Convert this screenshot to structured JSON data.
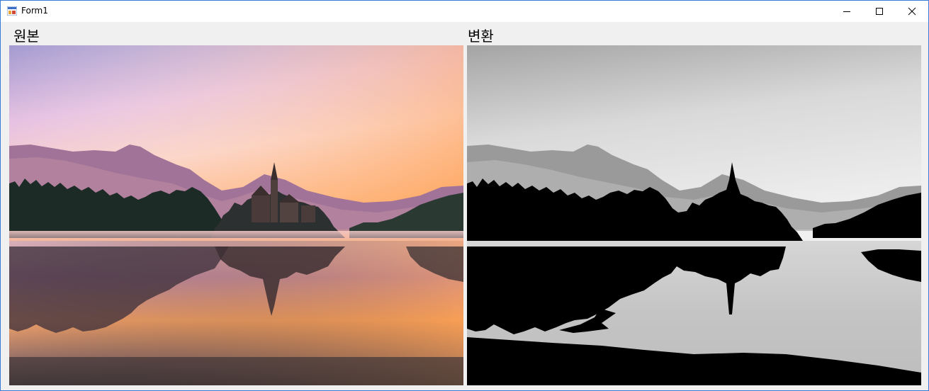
{
  "window": {
    "title": "Form1",
    "icon": "winforms-app-icon",
    "controls": [
      "minimize-icon",
      "maximize-icon",
      "close-icon"
    ]
  },
  "labels": {
    "original": "원본",
    "converted": "변환"
  },
  "images": {
    "original": {
      "content": "lake-church-island-sunrise-color",
      "colors": {
        "sky_top": "#a59ccf",
        "sky_mid": "#f1c6dd",
        "sky_low": "#ffa459",
        "mountain": "#a07396",
        "forest": "#1b2a24",
        "water_reflection": "#f59147"
      }
    },
    "converted": {
      "content": "lake-church-island-sunrise-grayscale-threshold",
      "colors": {
        "sky_top": "#a7a7a7",
        "sky_low": "#f2f2f2",
        "mountain": "#8e8e8e",
        "silhouette": "#000000",
        "water": "#cfcfcf"
      }
    }
  }
}
